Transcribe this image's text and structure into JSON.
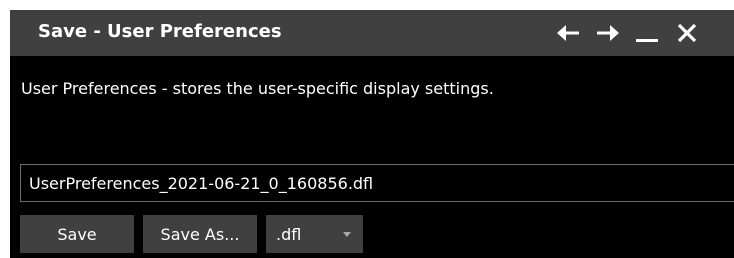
{
  "window": {
    "title": "Save - User Preferences",
    "icons": {
      "back": "arrow-left-icon",
      "forward": "arrow-right-icon",
      "minimize": "minimize-icon",
      "close": "close-icon"
    }
  },
  "main": {
    "description": "User Preferences - stores the user-specific display settings.",
    "filename": "UserPreferences_2021-06-21_0_160856.dfl"
  },
  "actions": {
    "save_label": "Save",
    "save_as_label": "Save As...",
    "file_type_selected": ".dfl"
  },
  "colors": {
    "background": "#000000",
    "titlebar": "#404040",
    "button": "#404040",
    "text": "#ffffff"
  }
}
